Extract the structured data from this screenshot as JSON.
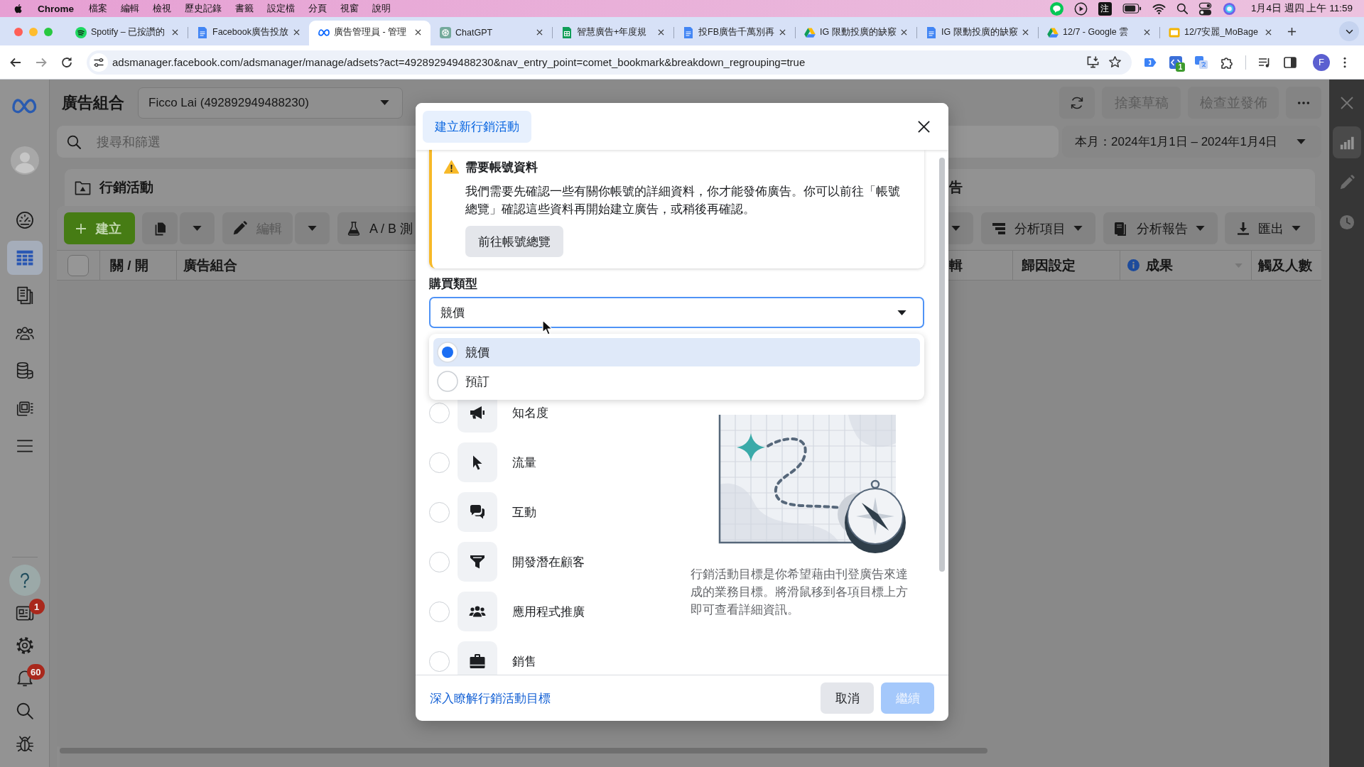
{
  "menu_bar": {
    "app": "Chrome",
    "menus": [
      "檔案",
      "編輯",
      "檢視",
      "歷史記錄",
      "書籤",
      "設定檔",
      "分頁",
      "視窗",
      "說明"
    ],
    "input_method": "注",
    "clock": "1月4日 週四 上午 11:59"
  },
  "browser": {
    "tabs": [
      {
        "title": "Spotify – 已按讚的",
        "kind": "spotify",
        "selected": false
      },
      {
        "title": "Facebook廣告投放",
        "kind": "doc",
        "selected": false
      },
      {
        "title": "廣告管理員 - 管理",
        "kind": "meta",
        "selected": true
      },
      {
        "title": "ChatGPT",
        "kind": "chatgpt",
        "selected": false
      },
      {
        "title": "智慧廣告+年度規",
        "kind": "sheet",
        "selected": false
      },
      {
        "title": "投FB廣告千萬別再",
        "kind": "doc",
        "selected": false
      },
      {
        "title": "IG 限動投廣的缺竅",
        "kind": "drive",
        "selected": false
      },
      {
        "title": "IG 限動投廣的缺竅",
        "kind": "doc",
        "selected": false
      },
      {
        "title": "12/7 - Google 雲",
        "kind": "drive",
        "selected": false
      },
      {
        "title": "12/7安麗_MoBage",
        "kind": "slides",
        "selected": false
      }
    ],
    "url": "adsmanager.facebook.com/adsmanager/manage/adsets?act=492892949488230&nav_entry_point=comet_bookmark&breakdown_regrouping=true",
    "extension_badge": "1",
    "profile": "F"
  },
  "app_sidebar": {
    "items": [
      {
        "kind": "gauge",
        "selected": false
      },
      {
        "kind": "table",
        "selected": true
      },
      {
        "kind": "pages",
        "selected": false
      },
      {
        "kind": "people",
        "selected": false
      },
      {
        "kind": "coins",
        "selected": false
      },
      {
        "kind": "media",
        "selected": false
      },
      {
        "kind": "menu",
        "selected": false
      }
    ],
    "tools": [
      {
        "kind": "help"
      },
      {
        "kind": "news",
        "badge": "1"
      },
      {
        "kind": "gear"
      },
      {
        "kind": "bell",
        "badge": "60"
      },
      {
        "kind": "search"
      },
      {
        "kind": "bug"
      }
    ]
  },
  "page": {
    "title": "廣告組合",
    "account": "Ficco Lai (492892949488230)",
    "actions": [
      {
        "label": "捨棄草稿",
        "disabled": true
      },
      {
        "label": "檢查並發佈",
        "disabled": true
      }
    ],
    "search": {
      "placeholder": "搜尋和篩選"
    },
    "date_range": "本月：2024年1月1日 – 2024年1月4日",
    "levels": [
      {
        "label": "行銷活動",
        "selected": false
      },
      {
        "label": "告",
        "selected": false
      }
    ],
    "toolbar": {
      "create": "建立",
      "edit": "編輯",
      "ab_test": "A / B 測",
      "breakdown": "分析項目",
      "reports": "分析報告",
      "export": "匯出"
    },
    "select_all": {
      "checked": false
    },
    "columns": [
      "關 / 開",
      "廣告組合",
      "輯",
      "歸因設定",
      "成果",
      "觸及人數"
    ]
  },
  "right_panel": {
    "tabs": [
      {
        "kind": "chart",
        "selected": true
      },
      {
        "kind": "pencil",
        "selected": false
      },
      {
        "kind": "clock",
        "selected": false
      }
    ]
  },
  "modal": {
    "title": "建立新行銷活動",
    "warning": {
      "title": "需要帳號資料",
      "text": "我們需要先確認一些有關你帳號的詳細資料，你才能發佈廣告。你可以前往「帳號總覽」確認這些資料再開始建立廣告，或稍後再確認。",
      "button": "前往帳號總覽"
    },
    "buying_type": {
      "label": "購買類型",
      "value": "競價",
      "options": [
        {
          "label": "競價",
          "selected": true
        },
        {
          "label": "預訂",
          "selected": false
        }
      ]
    },
    "objectives": [
      {
        "label": "知名度",
        "kind": "awareness",
        "selected": false
      },
      {
        "label": "流量",
        "kind": "traffic",
        "selected": false
      },
      {
        "label": "互動",
        "kind": "engagement",
        "selected": false
      },
      {
        "label": "開發潛在顧客",
        "kind": "leads",
        "selected": false
      },
      {
        "label": "應用程式推廣",
        "kind": "app",
        "selected": false
      },
      {
        "label": "銷售",
        "kind": "sales",
        "selected": false
      }
    ],
    "description": "行銷活動目標是你希望藉由刊登廣告來達成的業務目標。將滑鼠移到各項目標上方即可查看詳細資訊。",
    "learn_more": "深入瞭解行銷活動目標",
    "cancel": "取消",
    "continue": {
      "label": "繼續",
      "disabled": true
    }
  }
}
